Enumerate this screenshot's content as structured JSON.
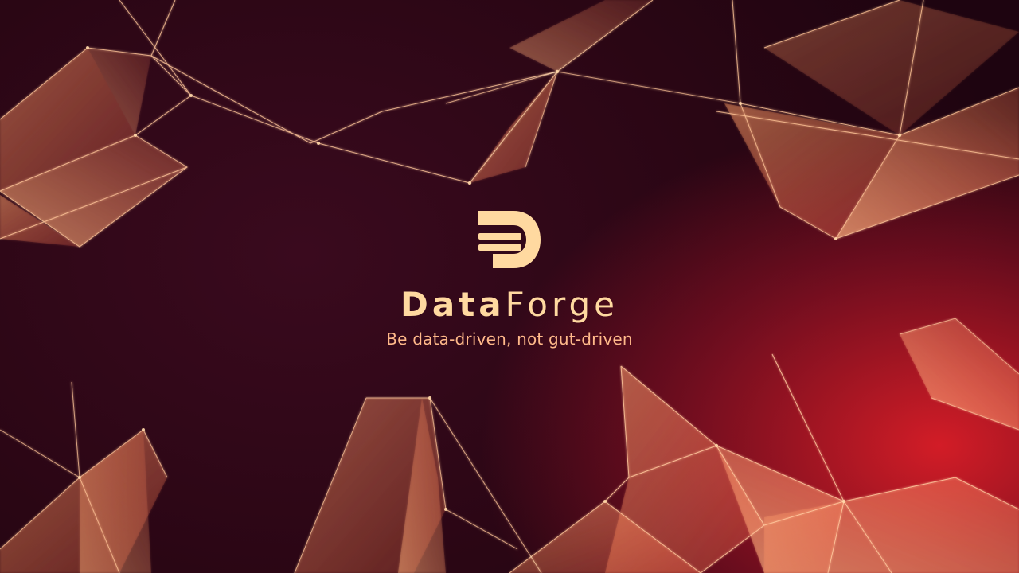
{
  "brand": {
    "name_bold": "Data",
    "name_light": "Forge",
    "tagline": "Be data-driven, not gut-driven",
    "logo_icon": "data-forge-d-logo-icon"
  },
  "colors": {
    "brand_text": "#ffd9a0",
    "tagline_text": "#ffb98a",
    "mesh_line": "#ffc590",
    "mesh_fill": "#ff8a4a",
    "background_dark": "#2a0614",
    "background_accent": "#d2202c"
  }
}
